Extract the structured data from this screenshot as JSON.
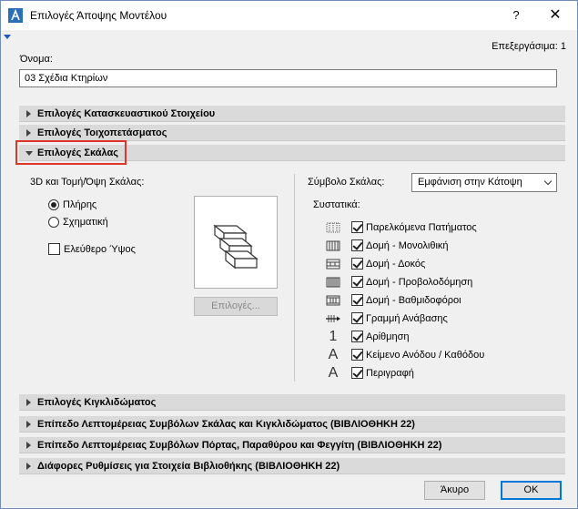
{
  "window": {
    "title": "Επιλογές Άποψης Μοντέλου",
    "help_glyph": "?",
    "close_glyph": "✕"
  },
  "edit_count": "Επεξεργάσιμα: 1",
  "name": {
    "label": "Όνομα:",
    "value": "03 Σχέδια Κτηρίων"
  },
  "sections_top": [
    {
      "label": "Επιλογές Κατασκευαστικού Στοιχείου"
    },
    {
      "label": "Επιλογές Τοιχοπετάσματος"
    },
    {
      "label": "Επιλογές Σκάλας"
    }
  ],
  "stair": {
    "left_title": "3D και Τομή/Όψη Σκάλας:",
    "radio_full": "Πλήρης",
    "radio_schematic": "Σχηματική",
    "free_height": "Ελεύθερο Ύψος",
    "options_button": "Επιλογές...",
    "symbol_label": "Σύμβολο Σκάλας:",
    "symbol_value": "Εμφάνιση στην Κάτοψη",
    "components_title": "Συστατικά:",
    "components": [
      {
        "label": "Παρελκόμενα Πατήματος",
        "icon": "tread-accessories-icon"
      },
      {
        "label": "Δομή - Μονολιθική",
        "icon": "structure-monolithic-icon"
      },
      {
        "label": "Δομή - Δοκός",
        "icon": "structure-beam-icon"
      },
      {
        "label": "Δομή - Προβολοδόμηση",
        "icon": "structure-cantilever-icon"
      },
      {
        "label": "Δομή - Βαθμιδοφόροι",
        "icon": "structure-stringer-icon"
      },
      {
        "label": "Γραμμή Ανάβασης",
        "icon": "walking-line-icon"
      },
      {
        "label": "Αρίθμηση",
        "icon": "numbering-icon",
        "glyph": "1"
      },
      {
        "label": "Κείμενο Ανόδου / Καθόδου",
        "icon": "text-icon",
        "glyph": "A"
      },
      {
        "label": "Περιγραφή",
        "icon": "description-icon",
        "glyph": "A"
      }
    ]
  },
  "sections_bottom": [
    {
      "label": "Επιλογές Κιγκλιδώματος"
    },
    {
      "label": "Επίπεδο Λεπτομέρειας Συμβόλων Σκάλας και Κιγκλιδώματος (ΒΙΒΛΙΟΘΗΚΗ 22)"
    },
    {
      "label": "Επίπεδο Λεπτομέρειας Συμβόλων Πόρτας, Παραθύρου και Φεγγίτη (ΒΙΒΛΙΟΘΗΚΗ 22)"
    },
    {
      "label": "Διάφορες Ρυθμίσεις για Στοιχεία Βιβλιοθήκης (ΒΙΒΛΙΟΘΗΚΗ 22)"
    }
  ],
  "buttons": {
    "cancel": "Άκυρο",
    "ok": "OK"
  },
  "colors": {
    "highlight": "#e0352b",
    "accent": "#0078d7"
  }
}
